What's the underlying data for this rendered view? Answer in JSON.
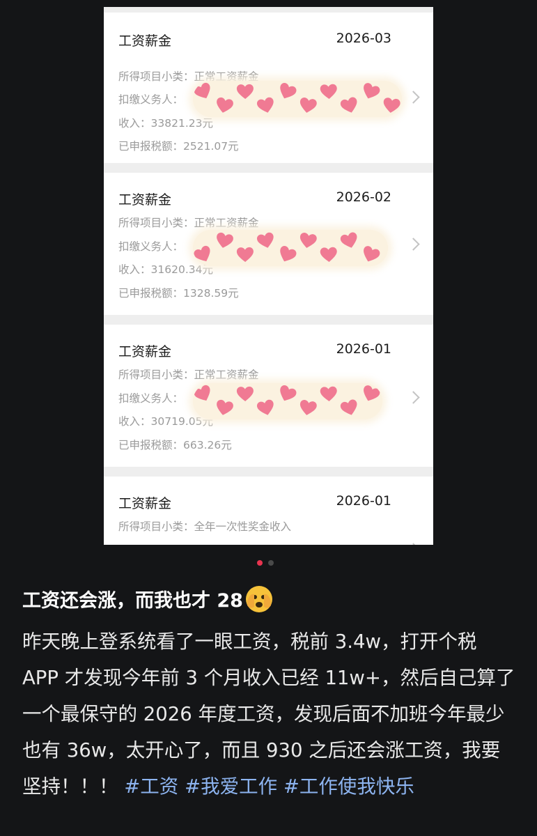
{
  "records": [
    {
      "title": "工资薪金",
      "date": "2026-03",
      "subcategory_label": "所得项目小类：",
      "subcategory": "正常工资薪金",
      "payer_label": "扣缴义务人：",
      "income_label": "收入：",
      "income": "33821.23元",
      "tax_label": "已申报税额：",
      "tax": "2521.07元"
    },
    {
      "title": "工资薪金",
      "date": "2026-02",
      "subcategory_label": "所得项目小类：",
      "subcategory": "正常工资薪金",
      "payer_label": "扣缴义务人：",
      "income_label": "收入：",
      "income": "31620.34元",
      "tax_label": "已申报税额：",
      "tax": "1328.59元"
    },
    {
      "title": "工资薪金",
      "date": "2026-01",
      "subcategory_label": "所得项目小类：",
      "subcategory": "正常工资薪金",
      "payer_label": "扣缴义务人：",
      "income_label": "收入：",
      "income": "30719.05元",
      "tax_label": "已申报税额：",
      "tax": "663.26元"
    },
    {
      "title": "工资薪金",
      "date": "2026-01",
      "subcategory_label": "所得项目小类：",
      "subcategory": "全年一次性奖金收入"
    }
  ],
  "post": {
    "title": "工资还会涨，而我也才 28",
    "title_emoji_icon": "face-with-peeking-eye-icon",
    "body": "昨天晚上登系统看了一眼工资，税前 3.4w，打开个税 APP 才发现今年前 3 个月收入已经 11w+，然后自己算了一个最保守的 2026 年度工资，发现后面不加班今年最少也有 36w，太开心了，而且 930 之后还会涨工资，我要坚持！！！",
    "tags": [
      "#工资",
      "#我爱工作",
      "#工作使我快乐"
    ]
  },
  "carousel": {
    "current": 1,
    "total": 2
  },
  "colors": {
    "background": "#141517",
    "accent": "#e8344f",
    "tag": "#8db4f0",
    "heart": "#f07a93"
  }
}
